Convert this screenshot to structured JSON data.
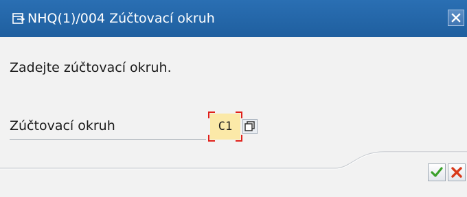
{
  "window": {
    "title": "NHQ(1)/004 Zúčtovací okruh",
    "title_icon": "dialog-window-icon",
    "close_icon": "close-icon"
  },
  "message": "Zadejte zúčtovací okruh.",
  "field": {
    "label": "Zúčtovací okruh",
    "value": "C1",
    "value_help_icon": "value-help-icon"
  },
  "actions": {
    "confirm_icon": "checkmark-icon",
    "cancel_icon": "cancel-x-icon"
  },
  "colors": {
    "titlebar": "#2a6fb3",
    "input_bg": "#fbe9a8",
    "focus_marker": "#e0201a",
    "confirm": "#3aa02a",
    "cancel": "#d83a1a"
  }
}
